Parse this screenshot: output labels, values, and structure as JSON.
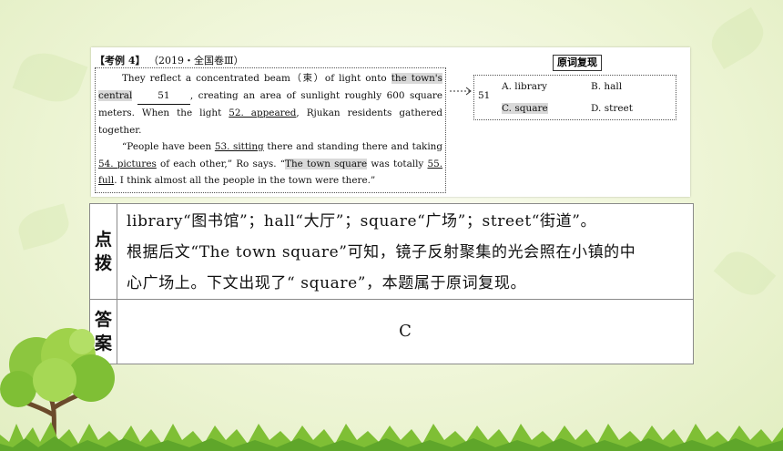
{
  "header": {
    "label": "【考例 4】",
    "source": "（2019・全国卷Ⅲ）"
  },
  "passage": {
    "p1_a": "They reflect a concentrated beam（束）of light onto ",
    "p1_hl": "the town's central",
    "blank51": "51",
    "p1_b": ", creating an area of sunlight roughly 600 square meters. When the light ",
    "blank52": "52. appeared",
    "p1_c": ", Rjukan residents gathered together.",
    "p2_a": "“People have been ",
    "blank53": "53. sitting",
    "p2_b": " there and standing there and taking ",
    "blank54": "54. pictures",
    "p2_c": " of each other,” Ro says. “",
    "p2_hl": "The town square",
    "p2_d": " was totally ",
    "blank55": "55. full",
    "p2_e": ". I think almost all the people in the town were there.”"
  },
  "review": {
    "title": "原词复现",
    "number": "51",
    "options": [
      "A. library",
      "B. hall",
      "C. square",
      "D. street"
    ]
  },
  "table": {
    "row1_label": [
      "点",
      "拨"
    ],
    "explain_line1": "library“图书馆”；hall“大厅”；square“广场”；street“街道”。",
    "explain_line2": "根据后文“The town square”可知，镜子反射聚集的光会照在小镇的中",
    "explain_line3": "心广场上。下文出现了“ square”，本题属于原词复现。",
    "row2_label": [
      "答",
      "案"
    ],
    "answer": "C"
  },
  "colors": {
    "background": "#eef5d6",
    "highlight": "#d9d9d9",
    "tree_leaves": "#8cc63f"
  }
}
